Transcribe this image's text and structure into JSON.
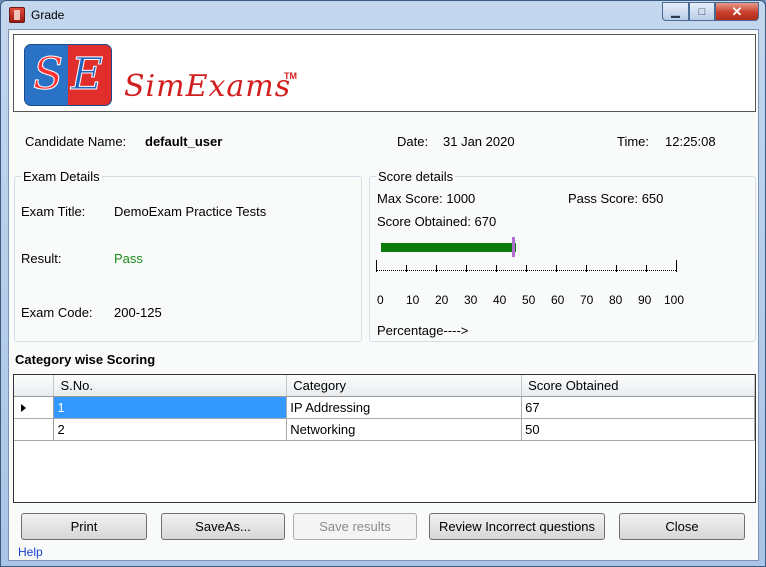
{
  "window": {
    "title": "Grade",
    "controls": {
      "minimize": "▁",
      "maximize": "□",
      "close": "✕"
    }
  },
  "brand": {
    "logo_left": "S",
    "logo_right": "E",
    "name": "SimExams",
    "tm": "TM"
  },
  "candidate": {
    "name_label": "Candidate Name:",
    "name": "default_user",
    "date_label": "Date:",
    "date": "31 Jan 2020",
    "time_label": "Time:",
    "time": "12:25:08"
  },
  "exam_details": {
    "title": "Exam Details",
    "exam_title_label": "Exam Title:",
    "exam_title": "DemoExam Practice Tests",
    "result_label": "Result:",
    "result": "Pass",
    "result_color": "#1a8a1a",
    "exam_code_label": "Exam Code:",
    "exam_code": "200-125"
  },
  "score_details": {
    "title": "Score details",
    "max_label": "Max Score: 1000",
    "pass_label": "Pass Score:  650",
    "obtained_label": "Score Obtained: 670",
    "max_score": 1000,
    "pass_score": 650,
    "obtained": 670,
    "percentage_label": "Percentage---->",
    "scale_labels": [
      "0",
      "10",
      "20",
      "30",
      "40",
      "50",
      "60",
      "70",
      "80",
      "90",
      "100"
    ],
    "bar_color": "#0a7a0a",
    "marker_color": "#b070d0"
  },
  "category": {
    "heading": "Category wise Scoring",
    "columns": [
      "S.No.",
      "Category",
      "Score Obtained"
    ],
    "rows": [
      {
        "sno": "1",
        "category": "IP Addressing",
        "score": "67"
      },
      {
        "sno": "2",
        "category": "Networking",
        "score": "50"
      }
    ]
  },
  "buttons": {
    "print": "Print",
    "save_as": "SaveAs...",
    "save_results": "Save results",
    "review": "Review Incorrect questions",
    "close": "Close"
  },
  "help": "Help"
}
